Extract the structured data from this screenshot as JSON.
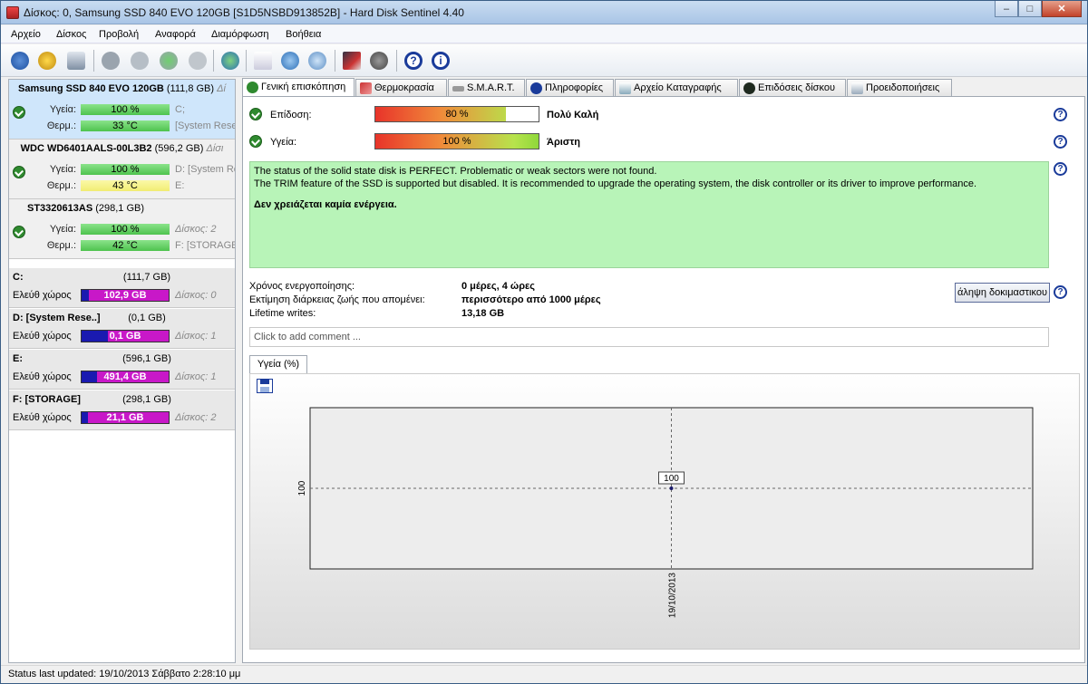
{
  "window": {
    "title": "Δίσκος: 0, Samsung SSD 840 EVO 120GB [S1D5NSBD913852B]  -  Hard Disk Sentinel 4.40",
    "minimize": "–",
    "maximize": "□",
    "close": "✕"
  },
  "menu": [
    "Αρχείο",
    "Δίσκος",
    "Προβολή",
    "Αναφορά",
    "Διαμόρφωση",
    "Βοήθεια"
  ],
  "toolbar": {
    "icons": [
      "refresh-icon",
      "warning-disk-icon",
      "disk-drive-icon",
      "disk-info-icon",
      "disk-test-icon",
      "disk-check-icon",
      "disk-tool-icon",
      "globe-icon",
      "report-icon",
      "sync-icon",
      "network-icon",
      "chart-icon",
      "sound-icon",
      "help-icon",
      "about-icon"
    ]
  },
  "disks": [
    {
      "name": "Samsung SSD 840 EVO 120GB",
      "size": "(111,8 GB)",
      "extra": "Δί",
      "health_label": "Υγεία:",
      "health": "100 %",
      "health_pct": 100,
      "temp_label": "Θερμ.:",
      "temp": "33 °C",
      "side1": "C;",
      "side2": "[System Rese",
      "selected": true
    },
    {
      "name": "WDC WD6401AALS-00L3B2",
      "size": "(596,2 GB)",
      "extra": "Δίσι",
      "health_label": "Υγεία:",
      "health": "100 %",
      "health_pct": 100,
      "temp_label": "Θερμ.:",
      "temp": "43 °C",
      "side1": "D: [System Re",
      "side2": "E:",
      "selected": false
    },
    {
      "name": "ST3320613AS",
      "size": "(298,1 GB)",
      "extra": "",
      "health_label": "Υγεία:",
      "health": "100 %",
      "health_pct": 100,
      "temp_label": "Θερμ.:",
      "temp": "42 °C",
      "side1": "Δίσκος: 2",
      "side2": "F: [STORAGE]",
      "selected": false
    }
  ],
  "volumes": [
    {
      "name": "C:",
      "size": "(111,7 GB)",
      "free_label": "Ελεύθ χώρος",
      "free": "102,9 GB",
      "free_fraction": 0.92,
      "disk": "Δίσκος: 0"
    },
    {
      "name": "D: [System Rese..]",
      "size": "(0,1 GB)",
      "free_label": "Ελεύθ χώρος",
      "free": "0,1 GB",
      "free_fraction": 0.7,
      "disk": "Δίσκος: 1"
    },
    {
      "name": "E:",
      "size": "(596,1 GB)",
      "free_label": "Ελεύθ χώρος",
      "free": "491,4 GB",
      "free_fraction": 0.82,
      "disk": "Δίσκος: 1"
    },
    {
      "name": "F: [STORAGE]",
      "size": "(298,1 GB)",
      "free_label": "Ελεύθ χώρος",
      "free": "21,1 GB",
      "free_fraction": 0.07,
      "disk": "Δίσκος: 2"
    }
  ],
  "tabs": [
    {
      "label": "Γενική επισκόπηση",
      "active": true
    },
    {
      "label": "Θερμοκρασία"
    },
    {
      "label": "S.M.A.R.T."
    },
    {
      "label": "Πληροφορίες"
    },
    {
      "label": "Αρχείο Καταγραφής"
    },
    {
      "label": "Επιδόσεις δίσκου"
    },
    {
      "label": "Προειδοποιήσεις"
    }
  ],
  "overview": {
    "performance_label": "Επίδοση:",
    "performance": "80 %",
    "performance_pct": 80,
    "performance_text": "Πολύ Καλή",
    "health_label": "Υγεία:",
    "health": "100 %",
    "health_pct": 100,
    "health_text": "Άριστη",
    "status_line1": "The status of the solid state disk is PERFECT. Problematic or weak sectors were not found.",
    "status_line2": "The TRIM feature of the SSD is supported but disabled. It is recommended to upgrade the operating system, the disk controller or its driver to improve performance.",
    "status_action": "Δεν χρειάζεται καμία ενέργεια.",
    "power_on_label": "Χρόνος ενεργοποίησης:",
    "power_on": "0 μέρες, 4 ώρες",
    "lifetime_label": "Εκτίμηση διάρκειας ζωής που απομένει:",
    "lifetime": "περισσότερο από 1000 μέρες",
    "writes_label": "Lifetime writes:",
    "writes": "13,18 GB",
    "test_button": "άληψη δοκιμαστικου",
    "comment_placeholder": "Click to add comment ...",
    "chart_tab": "Υγεία (%)"
  },
  "chart_data": {
    "type": "line",
    "x": [
      "19/10/2013"
    ],
    "y": [
      100
    ],
    "point_label": "100",
    "ytick": "100",
    "xtick": "19/10/2013",
    "grid": true
  },
  "status": "Status last updated: 19/10/2013 Σάββατο 2:28:10 μμ"
}
